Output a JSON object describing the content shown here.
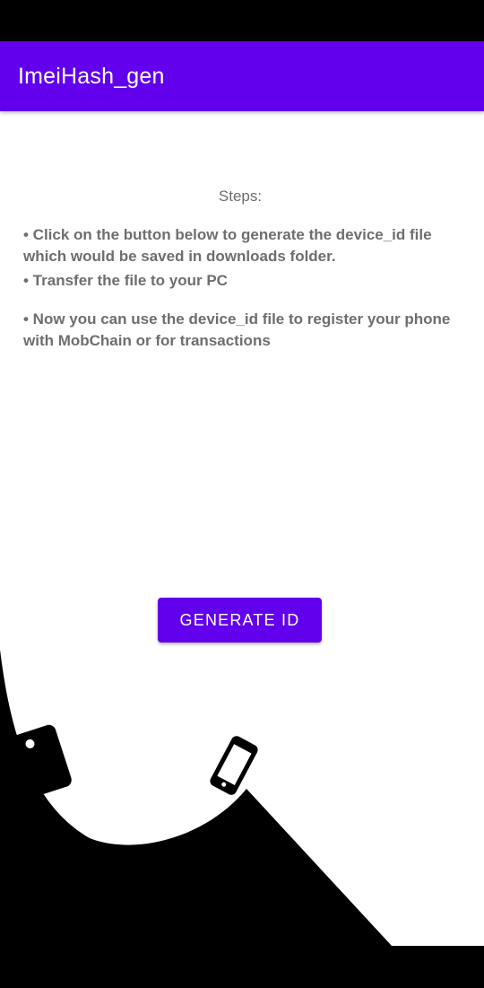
{
  "app_bar": {
    "title": "ImeiHash_gen",
    "color": "#6200EE"
  },
  "steps": {
    "heading": "Steps:",
    "items": [
      "• Click on the button below to generate the device_id file which would be saved in downloads folder.",
      "• Transfer the file to your PC",
      "• Now you can use the device_id file to register your phone with MobChain or for transactions"
    ],
    "lines": [
      [
        "• Click on the button below to generate the device_id file",
        "which would be saved in downloads folder."
      ],
      [
        "• Transfer the file to your PC"
      ],
      [
        "• Now you can use the device_id file to register your phone",
        "with MobChain or for transactions"
      ]
    ]
  },
  "button": {
    "label": "GENERATE ID"
  },
  "icons": {
    "left": "phone-icon",
    "right": "smartphone-icon"
  }
}
